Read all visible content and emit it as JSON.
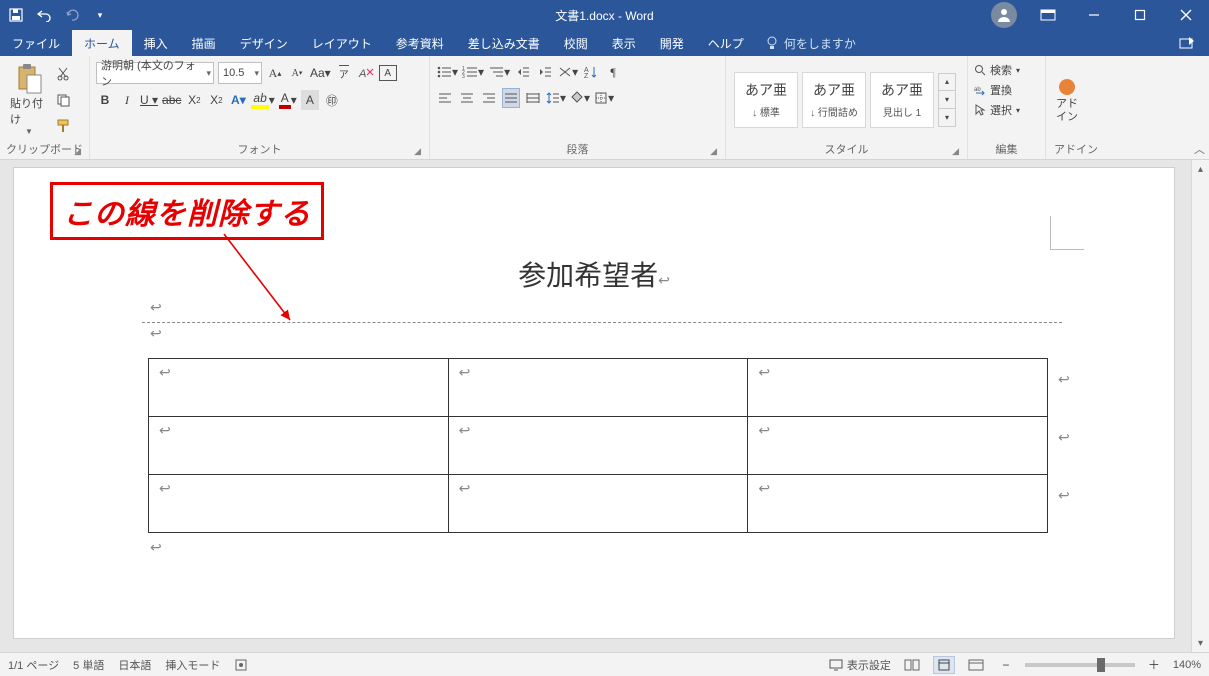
{
  "titlebar": {
    "doc_title": "文書1.docx  -  Word"
  },
  "menu": {
    "tabs": [
      "ファイル",
      "ホーム",
      "挿入",
      "描画",
      "デザイン",
      "レイアウト",
      "参考資料",
      "差し込み文書",
      "校閲",
      "表示",
      "開発",
      "ヘルプ"
    ],
    "active_index": 1,
    "tell_me": "何をしますか"
  },
  "ribbon": {
    "clipboard": {
      "paste": "貼り付け",
      "label": "クリップボード"
    },
    "font": {
      "name": "游明朝 (本文のフォン",
      "size": "10.5",
      "label": "フォント"
    },
    "paragraph": {
      "label": "段落"
    },
    "styles": {
      "label": "スタイル",
      "items": [
        {
          "preview": "あア亜",
          "name": "↓ 標準"
        },
        {
          "preview": "あア亜",
          "name": "↓ 行間詰め"
        },
        {
          "preview": "あア亜",
          "name": "見出し 1"
        }
      ]
    },
    "editing": {
      "find": "検索",
      "replace": "置換",
      "select": "選択",
      "label": "編集"
    },
    "addins": {
      "btn": "アド\nイン",
      "label": "アドイン"
    }
  },
  "annotation": {
    "text": "この線を削除する"
  },
  "document": {
    "heading": "参加希望者"
  },
  "status": {
    "page": "1/1 ページ",
    "words": "5 単語",
    "lang": "日本語",
    "mode": "挿入モード",
    "display": "表示設定",
    "zoom": "140%"
  }
}
